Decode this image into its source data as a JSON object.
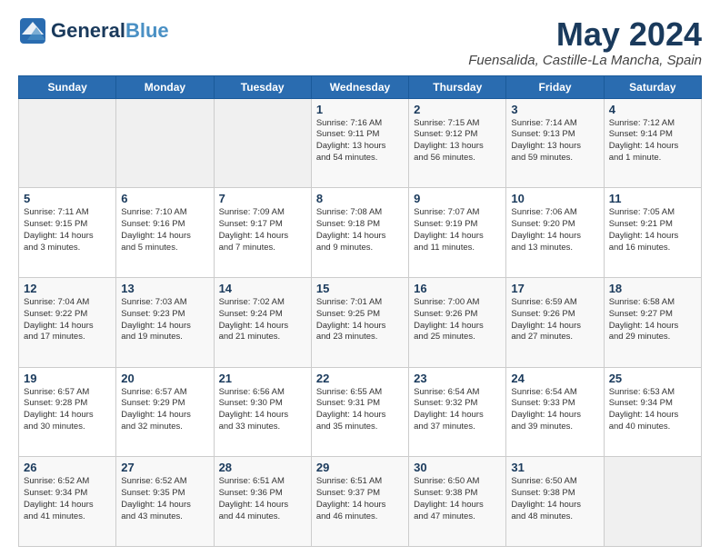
{
  "logo": {
    "line1": "General",
    "line2": "Blue"
  },
  "title": "May 2024",
  "subtitle": "Fuensalida, Castille-La Mancha, Spain",
  "days_of_week": [
    "Sunday",
    "Monday",
    "Tuesday",
    "Wednesday",
    "Thursday",
    "Friday",
    "Saturday"
  ],
  "weeks": [
    [
      {
        "day": "",
        "info": ""
      },
      {
        "day": "",
        "info": ""
      },
      {
        "day": "",
        "info": ""
      },
      {
        "day": "1",
        "info": "Sunrise: 7:16 AM\nSunset: 9:11 PM\nDaylight: 13 hours\nand 54 minutes."
      },
      {
        "day": "2",
        "info": "Sunrise: 7:15 AM\nSunset: 9:12 PM\nDaylight: 13 hours\nand 56 minutes."
      },
      {
        "day": "3",
        "info": "Sunrise: 7:14 AM\nSunset: 9:13 PM\nDaylight: 13 hours\nand 59 minutes."
      },
      {
        "day": "4",
        "info": "Sunrise: 7:12 AM\nSunset: 9:14 PM\nDaylight: 14 hours\nand 1 minute."
      }
    ],
    [
      {
        "day": "5",
        "info": "Sunrise: 7:11 AM\nSunset: 9:15 PM\nDaylight: 14 hours\nand 3 minutes."
      },
      {
        "day": "6",
        "info": "Sunrise: 7:10 AM\nSunset: 9:16 PM\nDaylight: 14 hours\nand 5 minutes."
      },
      {
        "day": "7",
        "info": "Sunrise: 7:09 AM\nSunset: 9:17 PM\nDaylight: 14 hours\nand 7 minutes."
      },
      {
        "day": "8",
        "info": "Sunrise: 7:08 AM\nSunset: 9:18 PM\nDaylight: 14 hours\nand 9 minutes."
      },
      {
        "day": "9",
        "info": "Sunrise: 7:07 AM\nSunset: 9:19 PM\nDaylight: 14 hours\nand 11 minutes."
      },
      {
        "day": "10",
        "info": "Sunrise: 7:06 AM\nSunset: 9:20 PM\nDaylight: 14 hours\nand 13 minutes."
      },
      {
        "day": "11",
        "info": "Sunrise: 7:05 AM\nSunset: 9:21 PM\nDaylight: 14 hours\nand 16 minutes."
      }
    ],
    [
      {
        "day": "12",
        "info": "Sunrise: 7:04 AM\nSunset: 9:22 PM\nDaylight: 14 hours\nand 17 minutes."
      },
      {
        "day": "13",
        "info": "Sunrise: 7:03 AM\nSunset: 9:23 PM\nDaylight: 14 hours\nand 19 minutes."
      },
      {
        "day": "14",
        "info": "Sunrise: 7:02 AM\nSunset: 9:24 PM\nDaylight: 14 hours\nand 21 minutes."
      },
      {
        "day": "15",
        "info": "Sunrise: 7:01 AM\nSunset: 9:25 PM\nDaylight: 14 hours\nand 23 minutes."
      },
      {
        "day": "16",
        "info": "Sunrise: 7:00 AM\nSunset: 9:26 PM\nDaylight: 14 hours\nand 25 minutes."
      },
      {
        "day": "17",
        "info": "Sunrise: 6:59 AM\nSunset: 9:26 PM\nDaylight: 14 hours\nand 27 minutes."
      },
      {
        "day": "18",
        "info": "Sunrise: 6:58 AM\nSunset: 9:27 PM\nDaylight: 14 hours\nand 29 minutes."
      }
    ],
    [
      {
        "day": "19",
        "info": "Sunrise: 6:57 AM\nSunset: 9:28 PM\nDaylight: 14 hours\nand 30 minutes."
      },
      {
        "day": "20",
        "info": "Sunrise: 6:57 AM\nSunset: 9:29 PM\nDaylight: 14 hours\nand 32 minutes."
      },
      {
        "day": "21",
        "info": "Sunrise: 6:56 AM\nSunset: 9:30 PM\nDaylight: 14 hours\nand 33 minutes."
      },
      {
        "day": "22",
        "info": "Sunrise: 6:55 AM\nSunset: 9:31 PM\nDaylight: 14 hours\nand 35 minutes."
      },
      {
        "day": "23",
        "info": "Sunrise: 6:54 AM\nSunset: 9:32 PM\nDaylight: 14 hours\nand 37 minutes."
      },
      {
        "day": "24",
        "info": "Sunrise: 6:54 AM\nSunset: 9:33 PM\nDaylight: 14 hours\nand 39 minutes."
      },
      {
        "day": "25",
        "info": "Sunrise: 6:53 AM\nSunset: 9:34 PM\nDaylight: 14 hours\nand 40 minutes."
      }
    ],
    [
      {
        "day": "26",
        "info": "Sunrise: 6:52 AM\nSunset: 9:34 PM\nDaylight: 14 hours\nand 41 minutes."
      },
      {
        "day": "27",
        "info": "Sunrise: 6:52 AM\nSunset: 9:35 PM\nDaylight: 14 hours\nand 43 minutes."
      },
      {
        "day": "28",
        "info": "Sunrise: 6:51 AM\nSunset: 9:36 PM\nDaylight: 14 hours\nand 44 minutes."
      },
      {
        "day": "29",
        "info": "Sunrise: 6:51 AM\nSunset: 9:37 PM\nDaylight: 14 hours\nand 46 minutes."
      },
      {
        "day": "30",
        "info": "Sunrise: 6:50 AM\nSunset: 9:38 PM\nDaylight: 14 hours\nand 47 minutes."
      },
      {
        "day": "31",
        "info": "Sunrise: 6:50 AM\nSunset: 9:38 PM\nDaylight: 14 hours\nand 48 minutes."
      },
      {
        "day": "",
        "info": ""
      }
    ]
  ]
}
